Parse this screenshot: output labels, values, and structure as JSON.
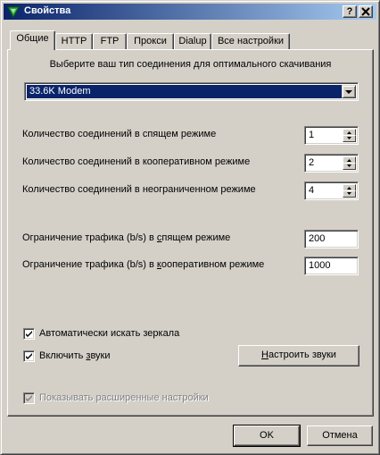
{
  "window": {
    "title": "Свойства",
    "help_btn": "?",
    "close_btn": "X"
  },
  "tabs": [
    {
      "label": "Общие",
      "active": true
    },
    {
      "label": "HTTP",
      "active": false
    },
    {
      "label": "FTP",
      "active": false
    },
    {
      "label": "Прокси",
      "active": false
    },
    {
      "label": "Dialup",
      "active": false
    },
    {
      "label": "Все настройки",
      "active": false
    }
  ],
  "connection": {
    "prompt": "Выберите ваш тип соединения для оптимального скачивания",
    "selected": "33.6K Modem"
  },
  "connections": [
    {
      "label": "Количество соединений в спящем режиме",
      "value": "1"
    },
    {
      "label": "Количество соединений в кооперативном режиме",
      "value": "2"
    },
    {
      "label": "Количество соединений в неограниченном режиме",
      "value": "4"
    }
  ],
  "traffic": [
    {
      "label_pre": "Ограничение трафика (b/s) в ",
      "label_u": "с",
      "label_post": "пящем режиме",
      "value": "200"
    },
    {
      "label_pre": "Ограничение трафика (b/s) в ",
      "label_u": "к",
      "label_post": "ооперативном режиме",
      "value": "1000"
    }
  ],
  "options": {
    "auto_mirror": {
      "label": "Автоматически искать зеркала",
      "checked": true
    },
    "sounds": {
      "label_pre": "Включить ",
      "label_u": "з",
      "label_post": "вуки",
      "checked": true
    },
    "configure_sounds_pre": "",
    "configure_sounds_u": "Н",
    "configure_sounds_post": "астроить звуки",
    "advanced": {
      "label": "Показывать расширенные настройки",
      "checked": true,
      "disabled": true
    }
  },
  "footer": {
    "ok": "OK",
    "cancel": "Отмена"
  },
  "colors": {
    "face": "#d4d0c8",
    "title_start": "#0a246a",
    "title_end": "#a6caf0",
    "selection": "#0a246a"
  },
  "icons": {
    "app": "green-triangle-icon",
    "check": "checkmark-icon",
    "dropdown": "triangle-down-icon",
    "spin_up": "triangle-up-icon",
    "spin_down": "triangle-down-icon"
  }
}
